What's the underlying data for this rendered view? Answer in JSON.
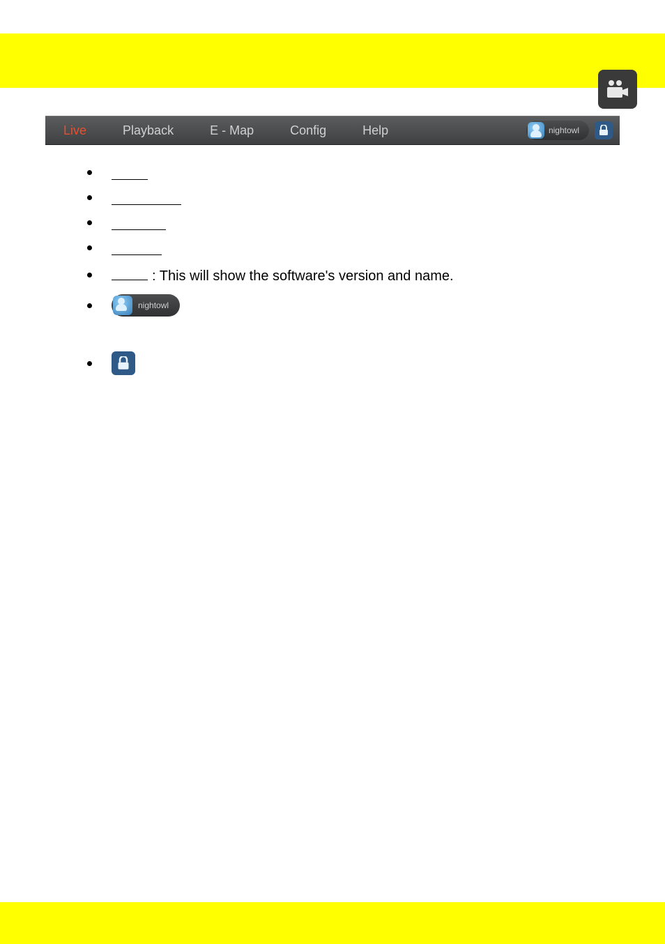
{
  "nav": {
    "live": "Live",
    "playback": "Playback",
    "emap": "E - Map",
    "config": "Config",
    "help": "Help",
    "user": "nightowl"
  },
  "bullets": {
    "help_text": ": This will show the software's version and name.",
    "user_pill_label": "nightowl"
  }
}
